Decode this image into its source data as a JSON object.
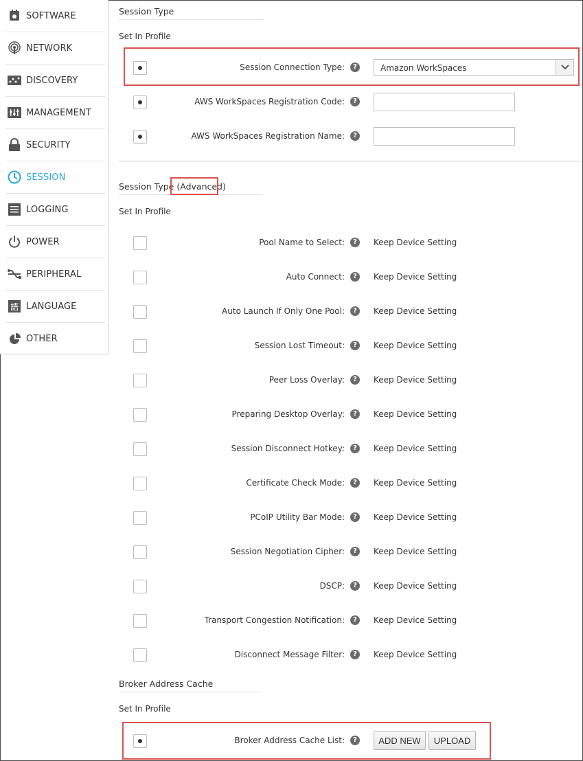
{
  "sidebar": {
    "items": [
      {
        "label": "SOFTWARE",
        "icon": "software-icon"
      },
      {
        "label": "NETWORK",
        "icon": "network-icon"
      },
      {
        "label": "DISCOVERY",
        "icon": "discovery-icon"
      },
      {
        "label": "MANAGEMENT",
        "icon": "management-icon"
      },
      {
        "label": "SECURITY",
        "icon": "lock-icon"
      },
      {
        "label": "SESSION",
        "icon": "clock-icon",
        "active": true
      },
      {
        "label": "LOGGING",
        "icon": "logging-icon"
      },
      {
        "label": "POWER",
        "icon": "power-icon"
      },
      {
        "label": "PERIPHERAL",
        "icon": "usb-icon"
      },
      {
        "label": "LANGUAGE",
        "icon": "language-icon"
      },
      {
        "label": "OTHER",
        "icon": "pie-icon"
      }
    ],
    "active_color": "#29a8dc"
  },
  "session_type": {
    "title": "Session Type",
    "set_in_profile": "Set In Profile",
    "connection_type": {
      "label": "Session Connection Type:",
      "value": "Amazon WorkSpaces",
      "checked": true
    },
    "reg_code": {
      "label": "AWS WorkSpaces Registration Code:",
      "value": "",
      "checked": true
    },
    "reg_name": {
      "label": "AWS WorkSpaces Registration Name:",
      "value": "",
      "checked": true
    },
    "help_glyph": "?"
  },
  "advanced": {
    "title_prefix": "Session Type",
    "title_suffix": "(Advanced)",
    "set_in_profile": "Set In Profile",
    "rows": [
      {
        "label": "Pool Name to Select:",
        "value": "Keep Device Setting"
      },
      {
        "label": "Auto Connect:",
        "value": "Keep Device Setting"
      },
      {
        "label": "Auto Launch If Only One Pool:",
        "value": "Keep Device Setting"
      },
      {
        "label": "Session Lost Timeout:",
        "value": "Keep Device Setting"
      },
      {
        "label": "Peer Loss Overlay:",
        "value": "Keep Device Setting"
      },
      {
        "label": "Preparing Desktop Overlay:",
        "value": "Keep Device Setting"
      },
      {
        "label": "Session Disconnect Hotkey:",
        "value": "Keep Device Setting"
      },
      {
        "label": "Certificate Check Mode:",
        "value": "Keep Device Setting"
      },
      {
        "label": "PCoIP Utility Bar Mode:",
        "value": "Keep Device Setting"
      },
      {
        "label": "Session Negotiation Cipher:",
        "value": "Keep Device Setting"
      },
      {
        "label": "DSCP:",
        "value": "Keep Device Setting"
      },
      {
        "label": "Transport Congestion Notification:",
        "value": "Keep Device Setting"
      },
      {
        "label": "Disconnect Message Filter:",
        "value": "Keep Device Setting"
      }
    ]
  },
  "broker": {
    "title": "Broker Address Cache",
    "set_in_profile": "Set In Profile",
    "row": {
      "label": "Broker Address Cache List:",
      "checked": true
    },
    "add_new_label": "ADD NEW",
    "upload_label": "UPLOAD"
  },
  "highlight_color": "#d9534f"
}
